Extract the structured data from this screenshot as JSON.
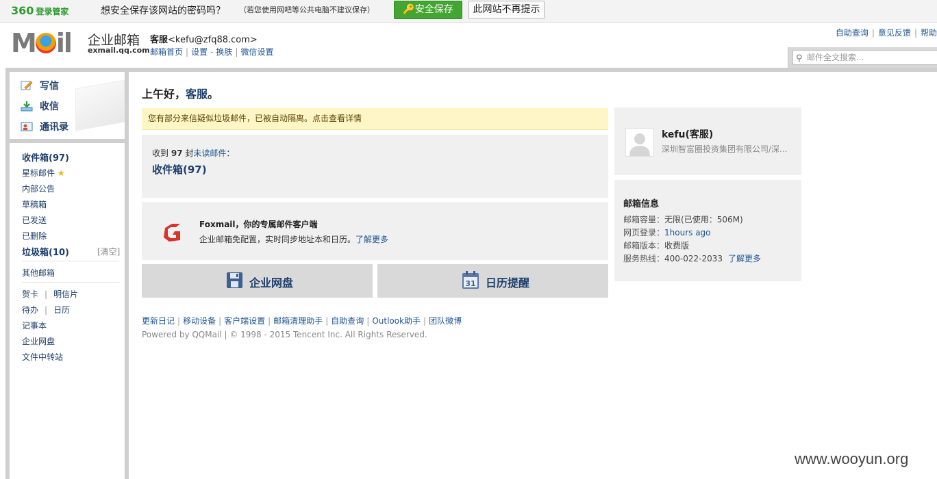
{
  "password_bar": {
    "brand": "360",
    "brand_sub": "登录管家",
    "question": "想安全保存该网站的密码吗？",
    "hint": "（若您使用网吧等公共电脑不建议保存）",
    "save_button": "安全保存",
    "never_button": "此网站不再提示"
  },
  "header": {
    "logo_text": "企业邮箱",
    "logo_domain": "exmail.qq.com",
    "user_name": "客服",
    "user_email": "<kefu@zfq88.com>",
    "nav": [
      "邮箱首页",
      "设置",
      "换肤",
      "微信设置"
    ],
    "nav_dash": "-",
    "top_links": [
      "自助查询",
      "意见反馈",
      "帮助"
    ],
    "search_placeholder": "邮件全文搜索..."
  },
  "sidebar": {
    "quick": [
      {
        "label": "写信",
        "icon": "compose-icon"
      },
      {
        "label": "收信",
        "icon": "inbox-download-icon"
      },
      {
        "label": "通讯录",
        "icon": "contacts-icon"
      }
    ],
    "inbox": "收件箱(97)",
    "starred": "星标邮件",
    "announcements": "内部公告",
    "drafts": "草稿箱",
    "sent": "已发送",
    "deleted": "已删除",
    "spam": "垃圾箱(10)",
    "spam_clear": "[清空]",
    "other_mailbox": "其他邮箱",
    "greeting_card": "贺卡",
    "postcard": "明信片",
    "todo": "待办",
    "calendar": "日历",
    "notepad": "记事本",
    "netdisk": "企业网盘",
    "file_transfer": "文件中转站"
  },
  "main": {
    "greeting_prefix": "上午好，",
    "greeting_name": "客服",
    "greeting_suffix": "。",
    "spam_warning": "您有部分来信疑似垃圾邮件，已被自动隔离。点击查看详情",
    "unread_prefix": "收到",
    "unread_count": "97",
    "unread_mid": "封",
    "unread_link": "未读邮件",
    "unread_suffix": "：",
    "unread_inbox": "收件箱(97)",
    "foxmail_title": "Foxmail，你的专属邮件客户端",
    "foxmail_desc": "企业邮箱免配置，实时同步地址本和日历。",
    "foxmail_more": "了解更多",
    "tile_disk": "企业网盘",
    "tile_calendar": "日历提醒",
    "calendar_day": "31"
  },
  "profile": {
    "name": "kefu(客服)",
    "company": "深圳智富圈投资集团有限公司/深..."
  },
  "mailbox_info": {
    "title": "邮箱信息",
    "capacity_label": "邮箱容量：",
    "capacity_value": "无限(已使用：506M)",
    "login_label": "网页登录：",
    "login_value": "1hours ago",
    "version_label": "邮箱版本：",
    "version_value": "收费版",
    "hotline_label": "服务热线：",
    "hotline_value": "400-022-2033",
    "hotline_more": "了解更多"
  },
  "footer": {
    "links": [
      "更新日记",
      "移动设备",
      "客户端设置",
      "邮箱清理助手",
      "自助查询",
      "Outlook助手",
      "团队微博"
    ],
    "copyright": "Powered by QQMail  | © 1998 - 2015 Tencent Inc. All Rights Reserved."
  },
  "watermark": "www.wooyun.org",
  "colors": {
    "accent_green": "#43a632",
    "link_blue": "#1e5494",
    "nav_dark_blue": "#1e3f6b",
    "warning_bg": "#fff6c8"
  }
}
